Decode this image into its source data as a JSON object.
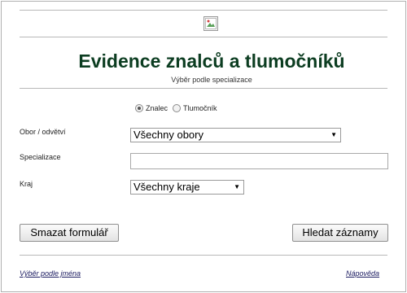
{
  "header": {
    "title": "Evidence znalců a tlumočníků",
    "subtitle": "Výběr podle specializace",
    "logo_icon": "broken-image-icon"
  },
  "form": {
    "type_options": [
      {
        "label": "Znalec",
        "checked": true
      },
      {
        "label": "Tlumočník",
        "checked": false
      }
    ],
    "field_label": "Obor / odvětví",
    "field_value": "Všechny obory",
    "specialization_label": "Specializace",
    "specialization_value": "",
    "region_label": "Kraj",
    "region_value": "Všechny kraje"
  },
  "buttons": {
    "clear": "Smazat formulář",
    "search": "Hledat záznamy"
  },
  "footer": {
    "by_name_link": "Výběr podle jména",
    "help_link": "Nápověda"
  }
}
